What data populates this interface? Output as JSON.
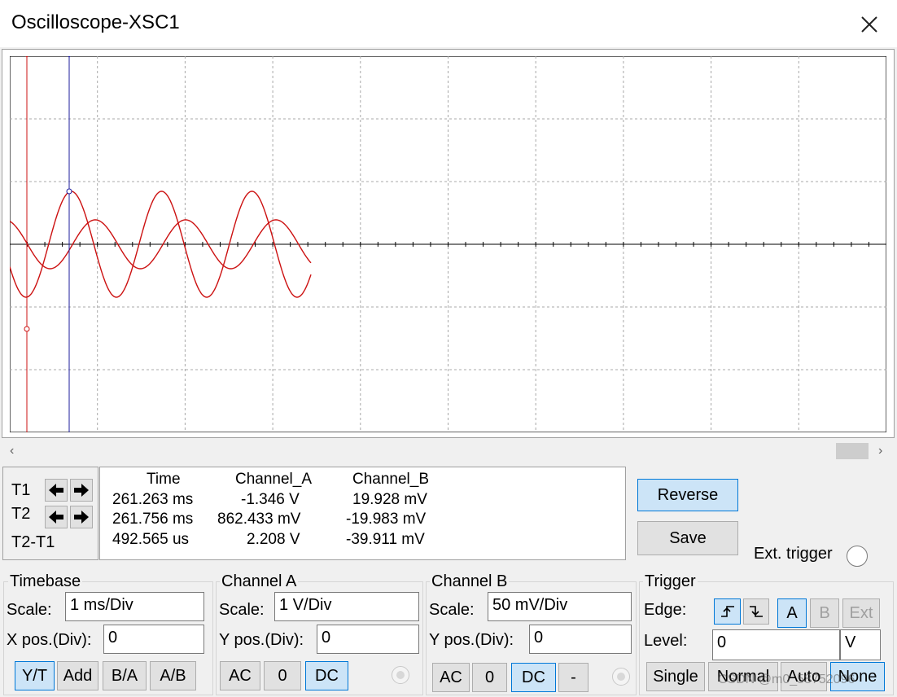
{
  "window": {
    "title": "Oscilloscope-XSC1",
    "close_icon": "close-icon"
  },
  "colors": {
    "trace": "#cc1111",
    "cursor_t1": "#cc1111",
    "cursor_t2": "#1c1c9c",
    "grid": "#a8a8a8",
    "axis": "#000000",
    "selected_button": "#cce4f7",
    "selected_border": "#0078d7"
  },
  "scrollbar": {
    "left_arrow": "‹",
    "right_arrow": "›"
  },
  "cursors": {
    "t1_label": "T1",
    "t2_label": "T2",
    "diff_label": "T2-T1",
    "left_icon": "arrow-left-icon",
    "right_icon": "arrow-right-icon"
  },
  "readout": {
    "headers": [
      "Time",
      "Channel_A",
      "Channel_B"
    ],
    "rows": [
      [
        "261.263 ms",
        "-1.346 V",
        "19.928 mV"
      ],
      [
        "261.756 ms",
        "862.433 mV",
        "-19.983 mV"
      ],
      [
        "492.565 us",
        "2.208 V",
        "-39.911 mV"
      ]
    ]
  },
  "actions": {
    "reverse": "Reverse",
    "save": "Save",
    "ext_trigger": "Ext. trigger"
  },
  "timebase": {
    "title": "Timebase",
    "scale_label": "Scale:",
    "scale_value": "1 ms/Div",
    "xpos_label": "X pos.(Div):",
    "xpos_value": "0",
    "modes": [
      "Y/T",
      "Add",
      "B/A",
      "A/B"
    ],
    "selected_mode": "Y/T"
  },
  "channel_a": {
    "title": "Channel A",
    "scale_label": "Scale:",
    "scale_value": "1  V/Div",
    "ypos_label": "Y pos.(Div):",
    "ypos_value": "0",
    "coupling": [
      "AC",
      "0",
      "DC"
    ],
    "selected_coupling": "DC"
  },
  "channel_b": {
    "title": "Channel B",
    "scale_label": "Scale:",
    "scale_value": "50 mV/Div",
    "ypos_label": "Y pos.(Div):",
    "ypos_value": "0",
    "coupling": [
      "AC",
      "0",
      "DC",
      "-"
    ],
    "selected_coupling": "DC"
  },
  "trigger": {
    "title": "Trigger",
    "edge_label": "Edge:",
    "edge_rising_icon": "rising-edge-icon",
    "edge_falling_icon": "falling-edge-icon",
    "sources": [
      "A",
      "B",
      "Ext"
    ],
    "selected_source": "A",
    "level_label": "Level:",
    "level_value": "0",
    "level_unit": "V",
    "modes": [
      "Single",
      "Normal",
      "Auto",
      "None"
    ],
    "selected_mode": "None"
  },
  "watermark": "CSDN @m0_58752096"
}
